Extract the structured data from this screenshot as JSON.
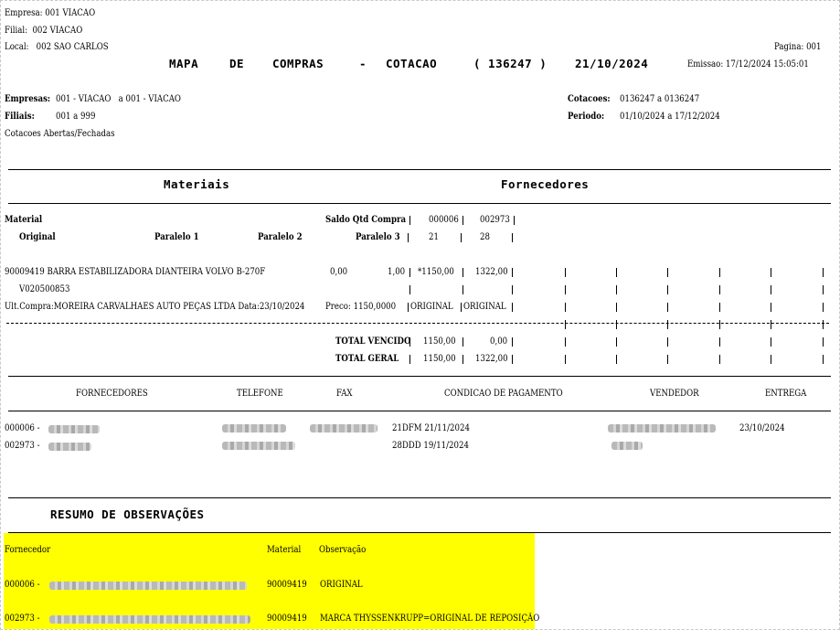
{
  "header": {
    "empresa": "Empresa: 001 VIACAO",
    "filial": "Filial:  002 VIACAO",
    "local": "Local:   002 SAO CARLOS",
    "pagina": "Pagina: 001",
    "title_mapa": "MAPA",
    "title_de": "DE",
    "title_compras": "COMPRAS",
    "title_dash": "-",
    "title_cotacao": "COTACAO",
    "title_number": "( 136247 )",
    "title_date": "21/10/2024",
    "emissao": "Emissao: 17/12/2024 15:05:01"
  },
  "filters": {
    "empresas_label": "Empresas:",
    "empresas_value": "001 - VIACAO   a 001 - VIACAO",
    "filiais_label": "Filiais:",
    "filiais_value": "001 a 999",
    "status": "Cotacoes Abertas/Fechadas",
    "cotacoes_label": "Cotacoes:",
    "cotacoes_value": "0136247 a 0136247",
    "periodo_label": "Periodo:",
    "periodo_value": "01/10/2024 a 17/12/2024"
  },
  "sections": {
    "materiais": "Materiais",
    "fornecedores": "Fornecedores"
  },
  "columns": {
    "material": "Material",
    "saldo": "Saldo Qtd Compra",
    "supplier1_code": "000006",
    "supplier2_code": "002973",
    "original": "Original",
    "paralelo1": "Paralelo 1",
    "paralelo2": "Paralelo 2",
    "paralelo3": "Paralelo 3",
    "supplier1_days": "21",
    "supplier2_days": "28"
  },
  "item": {
    "code_desc": "90009419 BARRA ESTABILIZADORA DIANTEIRA VOLVO B-270F",
    "saldo": "0,00",
    "qtd": "1,00",
    "price1": "*1150,00",
    "price2": "1322,00",
    "ref": "V020500853",
    "last_purchase": "Ult.Compra:MOREIRA CARVALHAES AUTO PEÇAS LTDA Data:23/10/2024",
    "preco": "Preco: 1150,0000",
    "orig1": "ORIGINAL",
    "orig2": "ORIGINAL"
  },
  "totals": {
    "vencido_label": "TOTAL VENCIDO",
    "vencido1": "1150,00",
    "vencido2": "0,00",
    "geral_label": "TOTAL GERAL",
    "geral1": "1150,00",
    "geral2": "1322,00"
  },
  "suppliers_table": {
    "headers": {
      "fornecedores": "FORNECEDORES",
      "telefone": "TELEFONE",
      "fax": "FAX",
      "condicao": "CONDICAO DE PAGAMENTO",
      "vendedor": "VENDEDOR",
      "entrega": "ENTREGA"
    },
    "rows": [
      {
        "code": "000006 -",
        "condicao": "21DFM 21/11/2024",
        "entrega": "23/10/2024"
      },
      {
        "code": "002973 -",
        "condicao": "28DDD 19/11/2024",
        "entrega": ""
      }
    ]
  },
  "observations": {
    "title": "RESUMO DE OBSERVAÇÕES",
    "headers": {
      "fornecedor": "Fornecedor",
      "material": "Material",
      "observacao": "Observação"
    },
    "rows": [
      {
        "code": "000006 -",
        "material": "90009419",
        "observacao": "ORIGINAL"
      },
      {
        "code": "002973 -",
        "material": "90009419",
        "observacao": "MARCA THYSSENKRUPP=ORIGINAL DE REPOSIÇÃO"
      }
    ]
  },
  "colors": {
    "highlight": "#ffff00",
    "text": "#000000",
    "redaction": "#b9b9b9"
  }
}
